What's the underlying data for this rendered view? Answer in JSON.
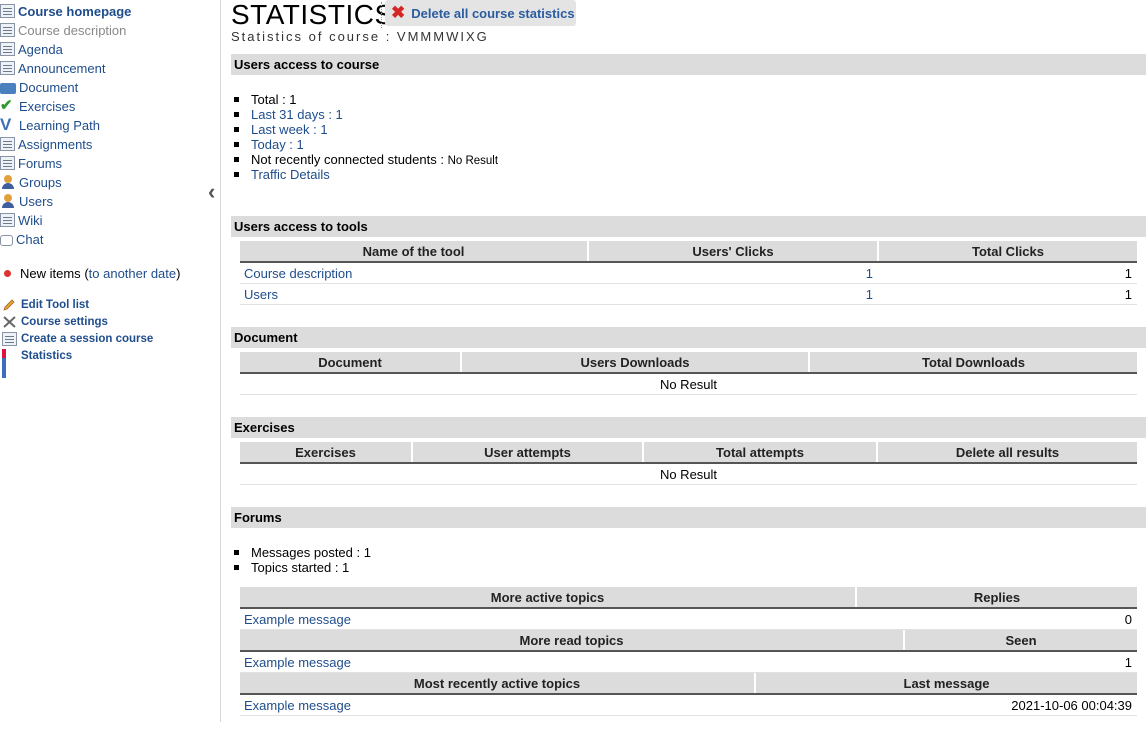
{
  "sidebar": {
    "items": [
      {
        "label": "Course homepage",
        "icon": "course-homepage-icon"
      },
      {
        "label": "Course description",
        "icon": "course-description-icon"
      },
      {
        "label": "Agenda",
        "icon": "agenda-icon"
      },
      {
        "label": "Announcement",
        "icon": "announcement-icon"
      },
      {
        "label": "Document",
        "icon": "document-folder-icon"
      },
      {
        "label": "Exercises",
        "icon": "exercises-check-icon"
      },
      {
        "label": "Learning Path",
        "icon": "learning-path-icon"
      },
      {
        "label": "Assignments",
        "icon": "assignments-icon"
      },
      {
        "label": "Forums",
        "icon": "forums-icon"
      },
      {
        "label": "Groups",
        "icon": "groups-icon"
      },
      {
        "label": "Users",
        "icon": "users-icon"
      },
      {
        "label": "Wiki",
        "icon": "wiki-icon"
      },
      {
        "label": "Chat",
        "icon": "chat-icon"
      }
    ],
    "new_items": {
      "label": "New items",
      "open_paren": "(",
      "link": "to another date",
      "close_paren": ")"
    },
    "admin_items": [
      {
        "label": "Edit Tool list",
        "icon": "pencil-icon"
      },
      {
        "label": "Course settings",
        "icon": "tools-icon"
      },
      {
        "label": "Create a session course",
        "icon": "session-course-icon"
      },
      {
        "label": "Statistics",
        "icon": "statistics-icon"
      }
    ],
    "collapse_icon": "chevron-left-icon"
  },
  "header": {
    "title": "STATISTICS",
    "delete_label": "Delete all course statistics",
    "subtitle": "Statistics of course : VMMMWIXG"
  },
  "access": {
    "title": "Users access to course",
    "total": "Total : 1",
    "last31": "Last 31 days : 1",
    "last_week": "Last week : 1",
    "today": "Today : 1",
    "not_connected_label": "Not recently connected students : ",
    "not_connected_value": "No Result",
    "traffic": "Traffic Details"
  },
  "tools": {
    "title": "Users access to tools",
    "headers": [
      "Name of the tool",
      "Users' Clicks",
      "Total Clicks"
    ],
    "rows": [
      {
        "name": "Course description",
        "users": "1",
        "total": "1"
      },
      {
        "name": "Users",
        "users": "1",
        "total": "1"
      }
    ]
  },
  "document": {
    "title": "Document",
    "headers": [
      "Document",
      "Users Downloads",
      "Total Downloads"
    ],
    "empty": "No Result"
  },
  "exercises": {
    "title": "Exercises",
    "headers": [
      "Exercises",
      "User attempts",
      "Total attempts",
      "Delete all results"
    ],
    "empty": "No Result"
  },
  "forums": {
    "title": "Forums",
    "messages_posted": "Messages posted : 1",
    "topics_started": "Topics started : 1",
    "active": {
      "headers": [
        "More active topics",
        "Replies"
      ],
      "row": {
        "name": "Example message",
        "value": "0"
      }
    },
    "read": {
      "headers": [
        "More read topics",
        "Seen"
      ],
      "row": {
        "name": "Example message",
        "value": "1"
      }
    },
    "recent": {
      "headers": [
        "Most recently active topics",
        "Last message"
      ],
      "row": {
        "name": "Example message",
        "value": "2021-10-06 00:04:39"
      }
    }
  }
}
